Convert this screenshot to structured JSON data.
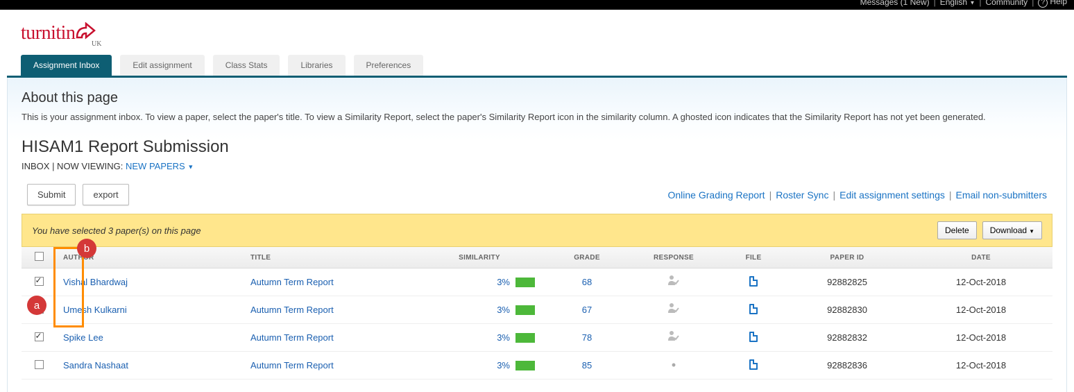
{
  "topbar": {
    "messages": "Messages (1 New)",
    "language": "English",
    "community": "Community",
    "help": "Help"
  },
  "logo": {
    "brand": "turnitin",
    "suffix": "UK"
  },
  "tabs": [
    {
      "label": "Assignment Inbox",
      "active": true
    },
    {
      "label": "Edit assignment",
      "active": false
    },
    {
      "label": "Class Stats",
      "active": false
    },
    {
      "label": "Libraries",
      "active": false
    },
    {
      "label": "Preferences",
      "active": false
    }
  ],
  "about": {
    "title": "About this page",
    "desc": "This is your assignment inbox. To view a paper, select the paper's title. To view a Similarity Report, select the paper's Similarity Report icon in the similarity column. A ghosted icon indicates that the Similarity Report has not yet been generated."
  },
  "assignment": {
    "title": "HISAM1 Report Submission",
    "viewing_prefix": "INBOX | NOW VIEWING: ",
    "viewing_filter": "NEW PAPERS"
  },
  "toolbar": {
    "submit": "Submit",
    "export": "export",
    "links": {
      "grading_report": "Online Grading Report",
      "roster_sync": "Roster Sync",
      "edit_settings": "Edit assignment settings",
      "email_non": "Email non-submitters"
    }
  },
  "selection": {
    "message": "You have selected 3 paper(s) on this page",
    "delete": "Delete",
    "download": "Download"
  },
  "table": {
    "headers": {
      "author": "AUTHOR",
      "title": "TITLE",
      "similarity": "SIMILARITY",
      "grade": "GRADE",
      "response": "RESPONSE",
      "file": "FILE",
      "paper_id": "PAPER ID",
      "date": "DATE"
    },
    "rows": [
      {
        "checked": true,
        "author": "Vishal Bhardwaj",
        "title": "Autumn Term Report",
        "similarity": "3%",
        "grade": "68",
        "response": "person",
        "paper_id": "92882825",
        "date": "12-Oct-2018"
      },
      {
        "checked": true,
        "author": "Umesh Kulkarni",
        "title": "Autumn Term Report",
        "similarity": "3%",
        "grade": "67",
        "response": "person",
        "paper_id": "92882830",
        "date": "12-Oct-2018"
      },
      {
        "checked": true,
        "author": "Spike Lee",
        "title": "Autumn Term Report",
        "similarity": "3%",
        "grade": "78",
        "response": "person",
        "paper_id": "92882832",
        "date": "12-Oct-2018"
      },
      {
        "checked": false,
        "author": "Sandra Nashaat",
        "title": "Autumn Term Report",
        "similarity": "3%",
        "grade": "85",
        "response": "dot",
        "paper_id": "92882836",
        "date": "12-Oct-2018"
      }
    ]
  },
  "annotations": {
    "a": "a",
    "b": "b"
  }
}
